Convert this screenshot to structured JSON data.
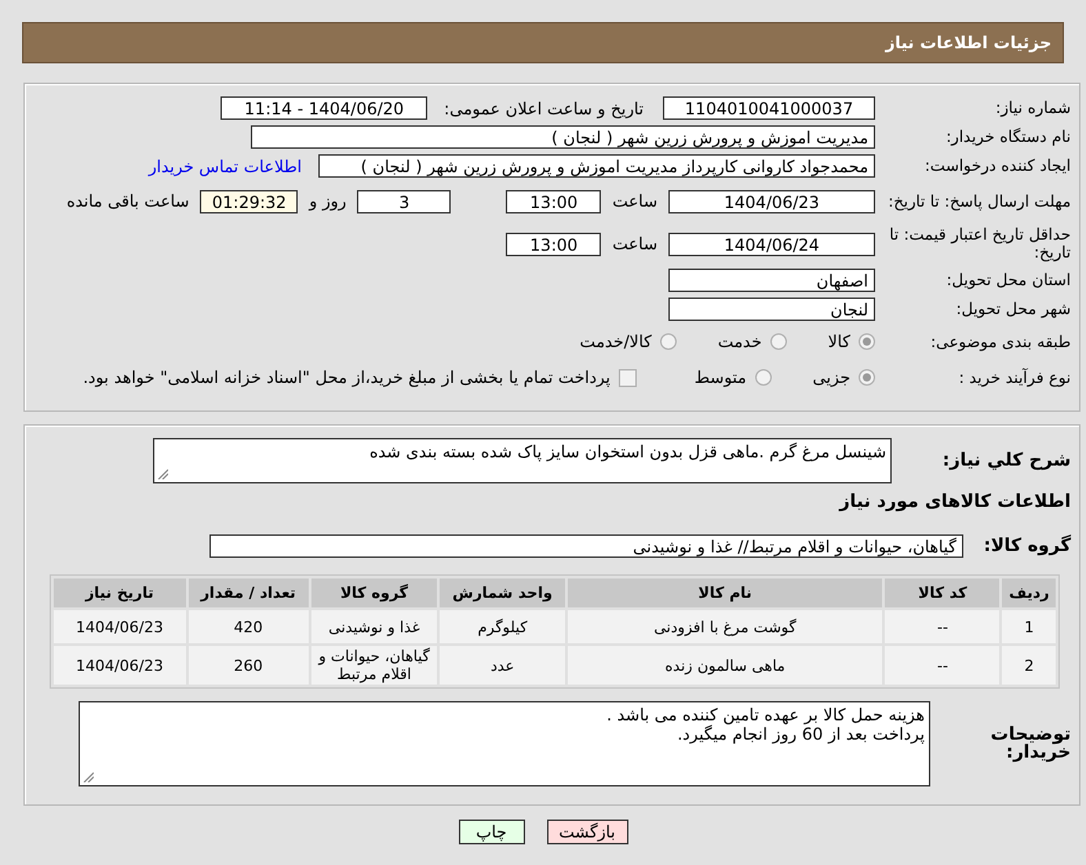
{
  "header": {
    "title": "جزئیات اطلاعات نیاز"
  },
  "need_number": {
    "label": "شماره نیاز:",
    "value": "1104010041000037"
  },
  "announce": {
    "label": "تاریخ و ساعت اعلان عمومی:",
    "value": "1404/06/20 - 11:14"
  },
  "buyer_org": {
    "label": "نام دستگاه خریدار:",
    "value": "مدیریت اموزش و پرورش زرین شهر ( لنجان )"
  },
  "creator": {
    "label": "ایجاد کننده درخواست:",
    "value": "محمدجواد کاروانی کارپرداز مدیریت اموزش و پرورش زرین شهر ( لنجان )",
    "link": "اطلاعات تماس خریدار"
  },
  "response_deadline": {
    "label": "مهلت ارسال پاسخ: تا تاریخ:",
    "date": "1404/06/23",
    "time_label": "ساعت",
    "time": "13:00",
    "days": "3",
    "days_label": "روز و",
    "remaining": "01:29:32",
    "remaining_label": "ساعت باقی مانده"
  },
  "price_validity": {
    "label": "حداقل تاریخ اعتبار قیمت: تا تاریخ:",
    "date": "1404/06/24",
    "time_label": "ساعت",
    "time": "13:00"
  },
  "province": {
    "label": "استان محل تحویل:",
    "value": "اصفهان"
  },
  "city": {
    "label": "شهر محل تحویل:",
    "value": "لنجان"
  },
  "category": {
    "label": "طبقه بندی موضوعی:",
    "options": [
      {
        "label": "کالا",
        "selected": true
      },
      {
        "label": "خدمت",
        "selected": false
      },
      {
        "label": "کالا/خدمت",
        "selected": false
      }
    ]
  },
  "purchase_type": {
    "label": "نوع فرآیند خرید :",
    "options": [
      {
        "label": "جزیی",
        "selected": true
      },
      {
        "label": "متوسط",
        "selected": false
      }
    ],
    "treasury": {
      "label": "پرداخت تمام یا بخشی از مبلغ خرید،از محل \"اسناد خزانه اسلامی\" خواهد بود.",
      "checked": false
    }
  },
  "description": {
    "label": "شرح کلي نياز:",
    "value": "شینسل مرغ گرم .ماهی قزل بدون استخوان سایز پاک شده بسته بندی شده"
  },
  "goods_section": {
    "title": "اطلاعات کالاهای مورد نیاز"
  },
  "goods_group": {
    "label": "گروه کالا:",
    "value": "گیاهان، حیوانات و اقلام مرتبط// غذا و نوشیدنی"
  },
  "table": {
    "columns": [
      "ردیف",
      "کد کالا",
      "نام کالا",
      "واحد شمارش",
      "گروه کالا",
      "تعداد / مقدار",
      "تاریخ نیاز"
    ],
    "rows": [
      [
        "1",
        "--",
        "گوشت مرغ با افزودنی",
        "کیلوگرم",
        "غذا و نوشیدنی",
        "420",
        "1404/06/23"
      ],
      [
        "2",
        "--",
        "ماهی سالمون زنده",
        "عدد",
        "گیاهان، حیوانات و اقلام مرتبط",
        "260",
        "1404/06/23"
      ]
    ]
  },
  "buyer_notes": {
    "label": "توضیحات خریدار:",
    "lines": [
      "هزینه حمل کالا بر عهده تامین کننده می باشد .",
      "پرداخت بعد از 60 روز انجام میگیرد."
    ]
  },
  "buttons": [
    {
      "label": "بازگشت",
      "kind": "back"
    },
    {
      "label": "چاپ",
      "kind": "print"
    }
  ]
}
